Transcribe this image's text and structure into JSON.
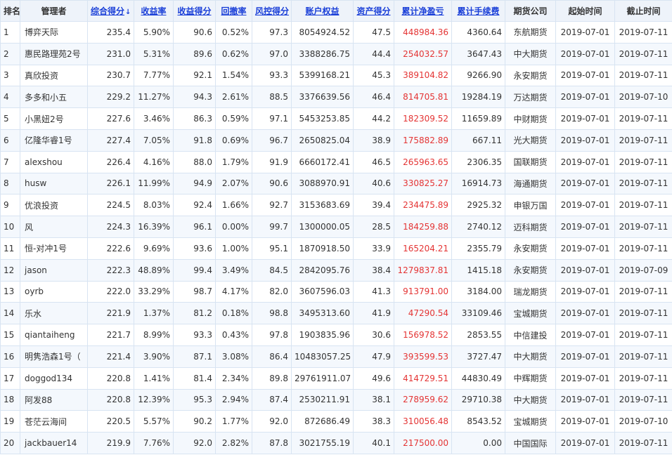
{
  "headers": [
    {
      "label": "排名",
      "sortable": false
    },
    {
      "label": "管理者",
      "sortable": false
    },
    {
      "label": "综合得分",
      "sortable": true,
      "active": true,
      "arrow": "↓"
    },
    {
      "label": "收益率",
      "sortable": true
    },
    {
      "label": "收益得分",
      "sortable": true
    },
    {
      "label": "回撤率",
      "sortable": true
    },
    {
      "label": "风控得分",
      "sortable": true
    },
    {
      "label": "账户权益",
      "sortable": true
    },
    {
      "label": "资产得分",
      "sortable": true
    },
    {
      "label": "累计净盈亏",
      "sortable": true
    },
    {
      "label": "累计手续费",
      "sortable": true
    },
    {
      "label": "期货公司",
      "sortable": false
    },
    {
      "label": "起始时间",
      "sortable": false
    },
    {
      "label": "截止时间",
      "sortable": false
    }
  ],
  "rows": [
    [
      "1",
      "博弈天际",
      "235.4",
      "5.90%",
      "90.6",
      "0.52%",
      "97.3",
      "8054924.52",
      "47.5",
      "448984.36",
      "4360.64",
      "东航期货",
      "2019-07-01",
      "2019-07-11"
    ],
    [
      "2",
      "惠民路理苑2号",
      "231.0",
      "5.31%",
      "89.6",
      "0.62%",
      "97.0",
      "3388286.75",
      "44.4",
      "254032.57",
      "3647.43",
      "中大期货",
      "2019-07-01",
      "2019-07-11"
    ],
    [
      "3",
      "真欣投资",
      "230.7",
      "7.77%",
      "92.1",
      "1.54%",
      "93.3",
      "5399168.21",
      "45.3",
      "389104.82",
      "9266.90",
      "永安期货",
      "2019-07-01",
      "2019-07-11"
    ],
    [
      "4",
      "多多和小五",
      "229.2",
      "11.27%",
      "94.3",
      "2.61%",
      "88.5",
      "3376639.56",
      "46.4",
      "814705.81",
      "19284.19",
      "万达期货",
      "2019-07-01",
      "2019-07-10"
    ],
    [
      "5",
      "小黑妞2号",
      "227.6",
      "3.46%",
      "86.3",
      "0.59%",
      "97.1",
      "5453253.85",
      "44.2",
      "182309.52",
      "11659.89",
      "中财期货",
      "2019-07-01",
      "2019-07-11"
    ],
    [
      "6",
      "亿隆华睿1号",
      "227.4",
      "7.05%",
      "91.8",
      "0.69%",
      "96.7",
      "2650825.04",
      "38.9",
      "175882.89",
      "667.11",
      "光大期货",
      "2019-07-01",
      "2019-07-11"
    ],
    [
      "7",
      "alexshou",
      "226.4",
      "4.16%",
      "88.0",
      "1.79%",
      "91.9",
      "6660172.41",
      "46.5",
      "265963.65",
      "2306.35",
      "国联期货",
      "2019-07-01",
      "2019-07-11"
    ],
    [
      "8",
      "husw",
      "226.1",
      "11.99%",
      "94.9",
      "2.07%",
      "90.6",
      "3088970.91",
      "40.6",
      "330825.27",
      "16914.73",
      "海通期货",
      "2019-07-01",
      "2019-07-11"
    ],
    [
      "9",
      "优浪投资",
      "224.5",
      "8.03%",
      "92.4",
      "1.66%",
      "92.7",
      "3153683.69",
      "39.4",
      "234475.89",
      "2925.32",
      "申银万国",
      "2019-07-01",
      "2019-07-11"
    ],
    [
      "10",
      "风",
      "224.3",
      "16.39%",
      "96.1",
      "0.00%",
      "99.7",
      "1300000.05",
      "28.5",
      "184259.88",
      "2740.12",
      "迈科期货",
      "2019-07-01",
      "2019-07-11"
    ],
    [
      "11",
      "恒-对冲1号",
      "222.6",
      "9.69%",
      "93.6",
      "1.00%",
      "95.1",
      "1870918.50",
      "33.9",
      "165204.21",
      "2355.79",
      "永安期货",
      "2019-07-01",
      "2019-07-11"
    ],
    [
      "12",
      "jason",
      "222.3",
      "48.89%",
      "99.4",
      "3.49%",
      "84.5",
      "2842095.76",
      "38.4",
      "1279837.81",
      "1415.18",
      "永安期货",
      "2019-07-01",
      "2019-07-09"
    ],
    [
      "13",
      "oyrb",
      "222.0",
      "33.29%",
      "98.7",
      "4.17%",
      "82.0",
      "3607596.03",
      "41.3",
      "913791.00",
      "3184.00",
      "瑞龙期货",
      "2019-07-01",
      "2019-07-11"
    ],
    [
      "14",
      "乐水",
      "221.9",
      "1.37%",
      "81.2",
      "0.18%",
      "98.8",
      "3495313.60",
      "41.9",
      "47290.54",
      "33109.46",
      "宝城期货",
      "2019-07-01",
      "2019-07-11"
    ],
    [
      "15",
      "qiantaiheng",
      "221.7",
      "8.99%",
      "93.3",
      "0.43%",
      "97.8",
      "1903835.96",
      "30.6",
      "156978.52",
      "2853.55",
      "中信建投",
      "2019-07-01",
      "2019-07-11"
    ],
    [
      "16",
      "明隽浩森1号（",
      "221.4",
      "3.90%",
      "87.1",
      "3.08%",
      "86.4",
      "10483057.25",
      "47.9",
      "393599.53",
      "3727.47",
      "中大期货",
      "2019-07-01",
      "2019-07-11"
    ],
    [
      "17",
      "doggod134",
      "220.8",
      "1.41%",
      "81.4",
      "2.34%",
      "89.8",
      "29761911.07",
      "49.6",
      "414729.51",
      "44830.49",
      "中辉期货",
      "2019-07-01",
      "2019-07-11"
    ],
    [
      "18",
      "阿发88",
      "220.8",
      "12.39%",
      "95.3",
      "2.94%",
      "87.4",
      "2530211.91",
      "38.1",
      "278959.62",
      "29710.38",
      "中大期货",
      "2019-07-01",
      "2019-07-11"
    ],
    [
      "19",
      "苍茫云海间",
      "220.5",
      "5.57%",
      "90.2",
      "1.77%",
      "92.0",
      "872686.49",
      "38.3",
      "310056.48",
      "8543.52",
      "宝城期货",
      "2019-07-01",
      "2019-07-10"
    ],
    [
      "20",
      "jackbauer14",
      "219.9",
      "7.76%",
      "92.0",
      "2.82%",
      "87.8",
      "3021755.19",
      "40.1",
      "217500.00",
      "0.00",
      "中国国际",
      "2019-07-01",
      "2019-07-11"
    ]
  ],
  "colors": {
    "link": "#1a3fd8",
    "profit": "#e43434",
    "header_bg": "#eef3fa",
    "border": "#d8e4f2"
  }
}
